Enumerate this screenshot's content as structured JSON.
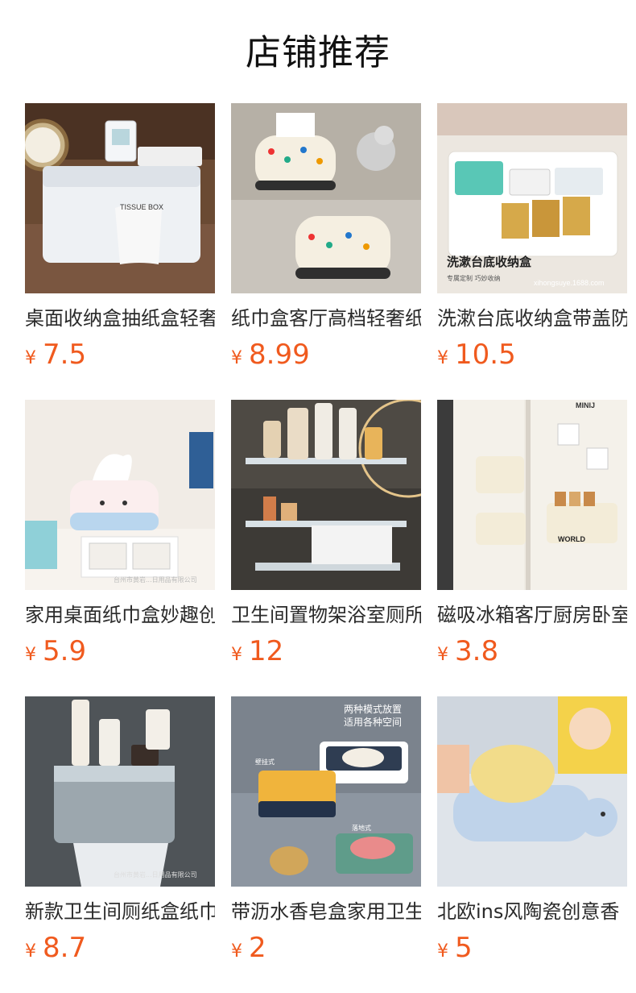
{
  "header": {
    "title": "店铺推荐"
  },
  "currency": "¥",
  "products": [
    {
      "name": "桌面收纳盒抽纸盒轻奢",
      "price": "7.5",
      "img_text": "TISSUE BOX"
    },
    {
      "name": "纸巾盒客厅高档轻奢纸",
      "price": "8.99",
      "img_text": ""
    },
    {
      "name": "洗漱台底收纳盒带盖防",
      "price": "10.5",
      "img_text": "洗漱台底收纳盒",
      "img_subtext": "专属定制 巧妙收纳",
      "img_watermark": "xihongsuye.1688.com"
    },
    {
      "name": "家用桌面纸巾盒妙趣创",
      "price": "5.9",
      "img_text": "",
      "img_watermark": "台州市黄岩...日用品有限公司"
    },
    {
      "name": "卫生间置物架浴室厕所",
      "price": "12",
      "img_text": ""
    },
    {
      "name": "磁吸冰箱客厅厨房卧室",
      "price": "3.8",
      "img_text": "WORLD",
      "img_subtext": "MINIJ"
    },
    {
      "name": "新款卫生间厕纸盒纸巾",
      "price": "8.7",
      "img_text": "",
      "img_watermark": "台州市黄岩...日用品有限公司"
    },
    {
      "name": "带沥水香皂盒家用卫生",
      "price": "2",
      "img_text": "两种模式放置",
      "img_subtext": "适用各种空间",
      "img_label_a": "壁挂式",
      "img_label_b": "落地式"
    },
    {
      "name": "北欧ins风陶瓷创意香",
      "price": "5",
      "img_text": ""
    }
  ]
}
